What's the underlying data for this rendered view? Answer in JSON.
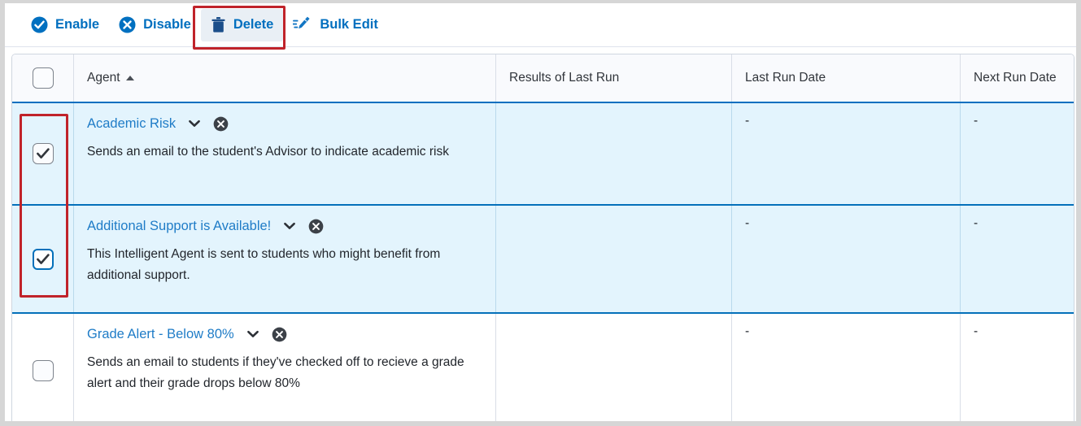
{
  "toolbar": {
    "buttons": [
      {
        "label": "Enable",
        "icon": "check-circle-icon",
        "state": "normal"
      },
      {
        "label": "Disable",
        "icon": "x-circle-icon",
        "state": "normal"
      },
      {
        "label": "Delete",
        "icon": "trash-icon",
        "state": "hover"
      },
      {
        "label": "Bulk Edit",
        "icon": "pencil-edit-icon",
        "state": "normal"
      }
    ]
  },
  "table": {
    "columns": [
      {
        "key": "select",
        "label": ""
      },
      {
        "key": "agent",
        "label": "Agent",
        "sort": "ascending"
      },
      {
        "key": "results",
        "label": "Results of Last Run"
      },
      {
        "key": "last",
        "label": "Last Run Date"
      },
      {
        "key": "next",
        "label": "Next Run Date"
      }
    ],
    "select_all_checked": false,
    "rows": [
      {
        "name": "Academic Risk",
        "description": "Sends an email to the student's Advisor to indicate academic risk",
        "results_of_last_run": "",
        "last_run_date": "-",
        "next_run_date": "-",
        "checked": true,
        "focused": false,
        "selected": true
      },
      {
        "name": "Additional Support is Available!",
        "description": "This Intelligent Agent is sent to students who might benefit from additional support.",
        "results_of_last_run": "",
        "last_run_date": "-",
        "next_run_date": "-",
        "checked": true,
        "focused": true,
        "selected": true
      },
      {
        "name": "Grade Alert - Below 80%",
        "description": "Sends an email to students if they've checked off to recieve a grade alert and their grade drops below 80%",
        "results_of_last_run": "",
        "last_run_date": "-",
        "next_run_date": "-",
        "checked": false,
        "focused": false,
        "selected": false
      }
    ]
  },
  "annotations": [
    {
      "target": "delete-button",
      "color": "#c0232a"
    },
    {
      "target": "row-checkboxes",
      "color": "#c0232a"
    }
  ],
  "colors": {
    "link": "#1f7cc7",
    "action_blue": "#006fbf",
    "row_selected_bg": "#e3f4fd",
    "row_selected_border": "#0470ba",
    "annotation_red": "#c0232a",
    "header_bg": "#f9fafd",
    "text": "#22262c"
  }
}
